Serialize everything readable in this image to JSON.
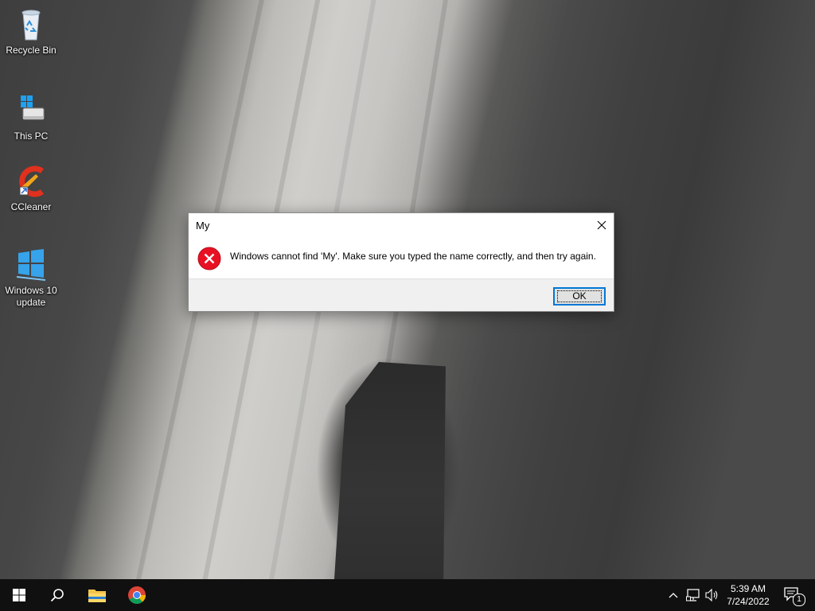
{
  "desktop": {
    "icons": [
      {
        "label": "Recycle Bin",
        "icon": "recycle-bin-icon"
      },
      {
        "label": "This PC",
        "icon": "computer-icon"
      },
      {
        "label": "CCleaner",
        "icon": "ccleaner-icon"
      },
      {
        "label": "Windows 10 update",
        "icon": "windows-update-icon"
      }
    ]
  },
  "dialog": {
    "title": "My",
    "message": "Windows cannot find 'My'. Make sure you typed the name correctly, and then try again.",
    "ok_label": "OK",
    "close_icon": "close-icon",
    "status_icon": "error-icon",
    "accent_color": "#0078d7",
    "error_color": "#e81123"
  },
  "taskbar": {
    "start_icon": "windows-start-icon",
    "search_icon": "search-icon",
    "pinned": [
      {
        "name": "File Explorer",
        "icon": "file-explorer-icon"
      },
      {
        "name": "Google Chrome",
        "icon": "chrome-icon"
      }
    ],
    "tray": {
      "icons": [
        "chevron-up-icon",
        "network-icon",
        "volume-icon"
      ],
      "time": "5:39 AM",
      "date": "7/24/2022",
      "notification_count": "1"
    }
  }
}
